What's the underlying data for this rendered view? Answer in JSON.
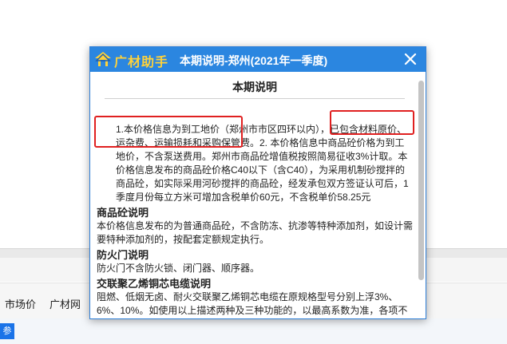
{
  "background": {
    "tabs": [
      "市场价",
      "广材网"
    ],
    "blue_chip_label": "参"
  },
  "dialog": {
    "brand": "广材助手",
    "title": "本期说明-郑州(2021年一季度)",
    "heading": "本期说明",
    "paragraph1": "1.本价格信息为到工地价（郑州市市区四环以内），已包含材料原价、运杂费、运输损耗和采购保管费。2. 本价格信息中商品砼价格为到工地价，不含泵送费用。郑州市商品砼增值税按照简易征收3%计取。本价格信息发布的商品砼价格C40以下（含C40），为采用机制砂搅拌的商品砼，如实际采用河砂搅拌的商品砼，经发承包双方签证认可后，1季度月份每立方米可增加含税单价60元，不含税单价58.25元",
    "section1_title": "商品砼说明",
    "section1_text": "本价格信息发布的为普通商品砼，不含防冻、抗渗等特种添加剂，如设计需要特种添加剂的，按配套定额规定执行。",
    "section2_title": "防火门说明",
    "section2_text": "防火门不含防火锁、闭门器、顺序器。",
    "section3_title": "交联聚乙烯铜芯电缆说明",
    "section3_text": "阻燃、低烟无卤、耐火交联聚乙烯铜芯电缆在原规格型号分别上浮3%、6%、10%。如使用以上描述两种及三种功能的，以最高系数为准，各项不"
  },
  "colors": {
    "titlebar": "#2b86e0",
    "brand": "#ffd23a",
    "highlight": "#e02020"
  }
}
